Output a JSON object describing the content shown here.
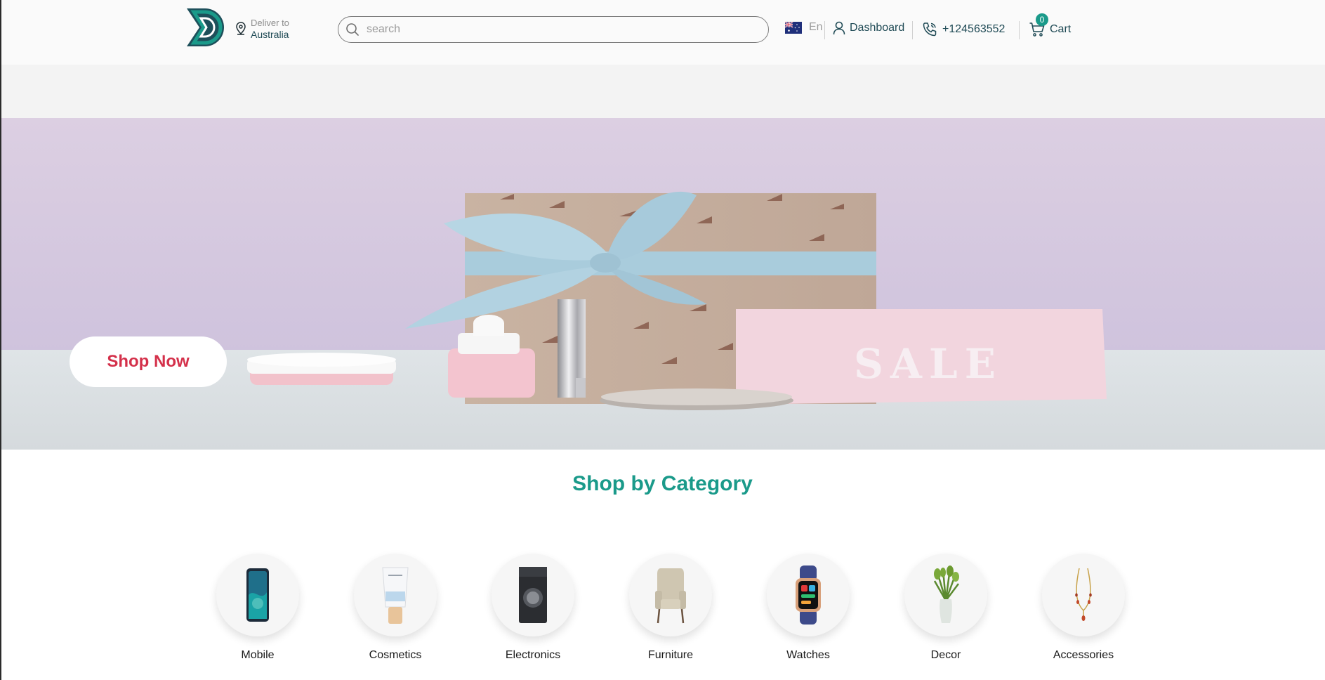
{
  "header": {
    "deliver_label": "Deliver to",
    "deliver_location": "Australia",
    "search_placeholder": "search",
    "language": "En",
    "dashboard_label": "Dashboard",
    "phone": "+124563552",
    "cart_label": "Cart",
    "cart_count": "0"
  },
  "hero": {
    "cta_label": "Shop Now",
    "sign_text": "SALE"
  },
  "categories": {
    "title": "Shop by Category",
    "items": [
      {
        "label": "Mobile",
        "icon": "mobile-phone-icon"
      },
      {
        "label": "Cosmetics",
        "icon": "cosmetics-tube-icon"
      },
      {
        "label": "Electronics",
        "icon": "washing-machine-icon"
      },
      {
        "label": "Furniture",
        "icon": "armchair-icon"
      },
      {
        "label": "Watches",
        "icon": "smartwatch-icon"
      },
      {
        "label": "Decor",
        "icon": "vase-icon"
      },
      {
        "label": "Accessories",
        "icon": "necklace-icon"
      }
    ]
  },
  "colors": {
    "brand_teal": "#1a9a8a",
    "cta_red": "#d4304a",
    "header_text": "#1f4a55"
  }
}
